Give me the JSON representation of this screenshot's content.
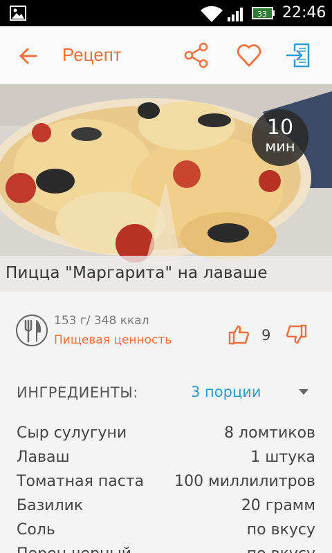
{
  "status_bar": {
    "time": "22:46",
    "battery_level": "33",
    "icons": [
      "gallery-icon",
      "wifi-icon",
      "signal-icon",
      "battery-icon"
    ]
  },
  "app_bar": {
    "title": "Рецепт",
    "icons": [
      "back-arrow-icon",
      "share-icon",
      "heart-icon",
      "exit-icon"
    ],
    "accent_color": "#f36f3c",
    "exit_icon_color": "#2f9ad8"
  },
  "hero": {
    "time_value": "10",
    "time_unit": "мин",
    "recipe_title": "Пицца \"Маргарита\" на лаваше"
  },
  "nutrition": {
    "weight_kcal": "153 г/ 348 ккал",
    "link_label": "Пищевая ценность",
    "likes": "9",
    "icons": [
      "fork-knife-icon",
      "thumbs-up-icon",
      "thumbs-down-icon"
    ]
  },
  "ingredients": {
    "header": "ИНГРЕДИЕНТЫ:",
    "portions": "3 порции",
    "portions_color": "#2f9ad8",
    "items": [
      {
        "name": "Сыр сулугуни",
        "qty": "8 ломтиков"
      },
      {
        "name": "Лаваш",
        "qty": "1 штука"
      },
      {
        "name": "Томатная паста",
        "qty": "100 миллилитров"
      },
      {
        "name": "Базилик",
        "qty": "20 грамм"
      },
      {
        "name": "Соль",
        "qty": "по вкусу"
      },
      {
        "name": "Перец черный",
        "qty": "по вкусу"
      }
    ]
  }
}
